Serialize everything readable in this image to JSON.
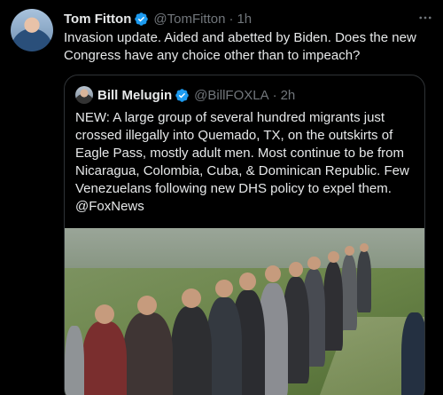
{
  "tweet": {
    "author_name": "Tom Fitton",
    "author_handle": "@TomFitton",
    "separator": "·",
    "time": "1h",
    "text": "Invasion update.  Aided and abetted by Biden.  Does the new Congress have any choice other than to impeach?",
    "more_icon": "ellipsis-icon"
  },
  "quote": {
    "author_name": "Bill Melugin",
    "author_handle": "@BillFOXLA",
    "separator": "·",
    "time": "2h",
    "text": "NEW: A large group of several hundred migrants just crossed illegally into Quemado, TX, on the outskirts of Eagle Pass, mostly adult men. Most continue to be from Nicaragua, Colombia, Cuba, & Dominican Republic. Few Venezuelans following new DHS policy to expel them. @FoxNews"
  },
  "colors": {
    "background": "#000000",
    "text": "#e7e9ea",
    "muted": "#71767b",
    "border": "#2f3336",
    "verified_badge": "#1d9bf0"
  }
}
